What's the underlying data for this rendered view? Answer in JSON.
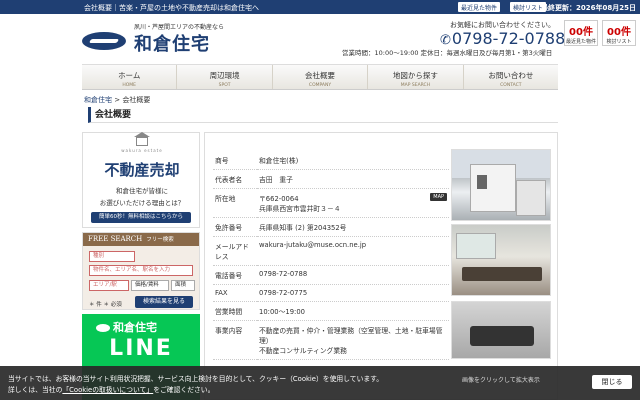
{
  "topbar": {
    "description": "会社概要｜苦楽・芦屋の土地や不動産売却は和倉住宅へ",
    "recent_label": "最近見た物件",
    "favorites_label": "検討リスト",
    "update_date": "最終更新：2026年08月25日"
  },
  "header": {
    "tagline": "夙川・芦屋間エリアの不動産なら",
    "logo_text": "和倉住宅",
    "contact_msg": "お気軽にお問い合わせください。",
    "phone": "0798-72-0788",
    "hours": "営業時間：10:00〜19:00 定休日：毎週水曜日及び毎月第1・第3火曜日",
    "recent_count": "00件",
    "recent_label": "最近見た物件",
    "fav_count": "00件",
    "fav_label": "検討リスト"
  },
  "nav": [
    {
      "jp": "ホーム",
      "en": "HOME"
    },
    {
      "jp": "周辺環境",
      "en": "SPOT"
    },
    {
      "jp": "会社概要",
      "en": "COMPANY"
    },
    {
      "jp": "地図から探す",
      "en": "MAP SEARCH"
    },
    {
      "jp": "お問い合わせ",
      "en": "CONTACT"
    }
  ],
  "breadcrumb": {
    "home": "和倉住宅",
    "sep": ">",
    "current": "会社概要"
  },
  "page_title": "会社概要",
  "sidebar": {
    "sell_brand": "wakura estate",
    "sell_title": "不動産売却",
    "sell_sub1": "和倉住宅が皆様に",
    "sell_sub2": "お選びいただける理由とは？",
    "sell_btn": "簡単60秒！無料相談はこちらから",
    "fs_title": "FREE SEARCH",
    "fs_sub": "フリー検索",
    "fs_type": "種別",
    "fs_keyword": "物件名、エリア名、駅名を入力",
    "fs_area": "エリア/駅",
    "fs_price": "価格/賃料",
    "fs_size": "面積",
    "fs_required": "＊ 件 ＊ 必須",
    "fs_button": "検索結果を見る",
    "line_brand": "和倉住宅",
    "line_text": "LINE"
  },
  "company": [
    {
      "label": "商号",
      "value": "和倉住宅(株)"
    },
    {
      "label": "代表者名",
      "value": "吉田　重子"
    },
    {
      "label": "所在地",
      "value": "〒662-0064",
      "value2": "兵庫県西宮市雲井町３－４",
      "map": "MAP"
    },
    {
      "label": "免許番号",
      "value": "兵庫県知事 (2) 第204352号"
    },
    {
      "label": "メールアドレス",
      "value": "wakura-jutaku@muse.ocn.ne.jp"
    },
    {
      "label": "電話番号",
      "value": "0798-72-0788"
    },
    {
      "label": "FAX",
      "value": "0798-72-0775"
    },
    {
      "label": "営業時間",
      "value": "10:00〜19:00"
    },
    {
      "label": "事業内容",
      "value": "不動産の売買・仲介・管理業務（空室管理、土地・駐車場管理）",
      "value2": "不動産コンサルティング業務"
    }
  ],
  "cookie": {
    "line1": "当サイトでは、お客様の当サイト利用状況把握、サービス向上検討を目的として、クッキー（Cookie）を使用しています。",
    "line2_pre": "詳しくは、当社の",
    "line2_link": "「Cookieの取扱いについて」",
    "line2_post": "をご確認ください。",
    "close": "閉じる",
    "caption": "画像をクリックして拡大表示"
  }
}
